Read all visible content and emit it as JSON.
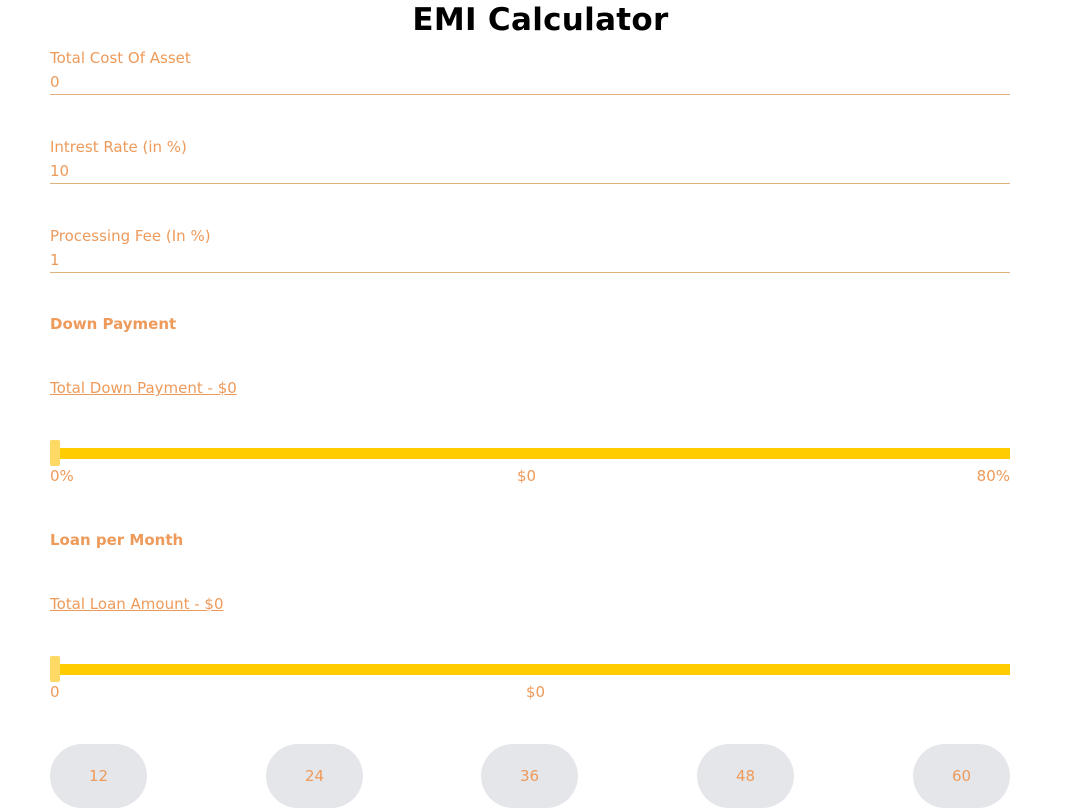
{
  "title": "EMI Calculator",
  "fields": {
    "cost": {
      "label": "Total Cost Of Asset",
      "value": "0"
    },
    "rate": {
      "label": "Intrest Rate (in %)",
      "value": "10"
    },
    "fee": {
      "label": "Processing Fee (In %)",
      "value": "1"
    }
  },
  "down_payment": {
    "title": "Down Payment",
    "total": "Total Down Payment - $0",
    "slider_fraction": 0,
    "min_label": "0%",
    "mid_label": "$0",
    "max_label": "80%"
  },
  "loan": {
    "title": "Loan per Month",
    "total": "Total Loan Amount - $0",
    "slider_fraction": 0,
    "min_label": "0",
    "mid_label": "$0"
  },
  "tenure_options": [
    "12",
    "24",
    "36",
    "48",
    "60"
  ],
  "colors": {
    "accent_text": "#ee9a5a",
    "slider_track": "#ffcc00",
    "slider_thumb": "#ffd966",
    "button_bg": "#e5e6ea"
  }
}
